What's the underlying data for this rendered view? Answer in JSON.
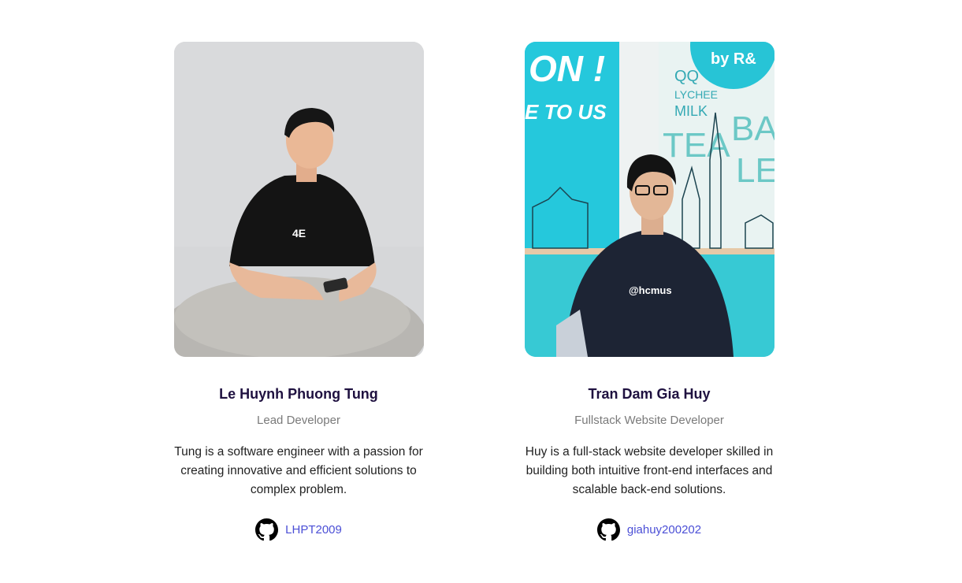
{
  "members": [
    {
      "name": "Le Huynh Phuong Tung",
      "role": "Lead Developer",
      "bio": "Tung is a software engineer with a passion for creating innovative and efficient solutions to complex problem.",
      "github": "LHPT2009",
      "shirt_logo": "4E"
    },
    {
      "name": "Tran Dam Gia Huy",
      "role": "Fullstack Website Developer",
      "bio": "Huy is a full-stack website developer skilled in building both intuitive front-end interfaces and scalable back-end solutions.",
      "github": "giahuy200202",
      "shirt_logo": "@hcmus",
      "mural_text": [
        "ON !",
        "E TO US",
        "by R&",
        "QQ",
        "LYCHEE",
        "MILK",
        "TEA",
        "BA",
        "LE"
      ]
    }
  ],
  "icons": {
    "github": "github-icon"
  },
  "colors": {
    "name": "#1f1140",
    "role": "#7a7a7a",
    "link": "#4b4fd6",
    "mural_cyan": "#22c9dc"
  }
}
